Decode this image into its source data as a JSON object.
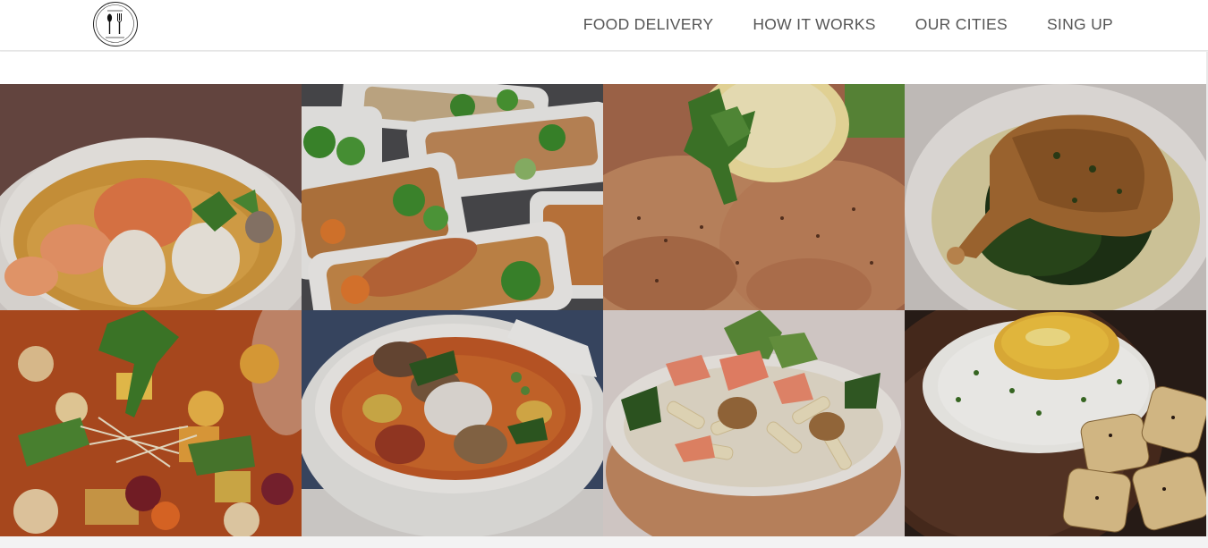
{
  "header": {
    "logo_icon": "fork-and-knife-logo",
    "nav": [
      {
        "label": "FOOD DELIVERY"
      },
      {
        "label": "HOW IT WORKS"
      },
      {
        "label": "OUR CITIES"
      },
      {
        "label": "SING UP"
      }
    ]
  },
  "gallery": {
    "photos": [
      {
        "name": "seafood-curry-photo"
      },
      {
        "name": "meal-prep-trays-photo"
      },
      {
        "name": "grilled-salmon-lemon-photo"
      },
      {
        "name": "roast-chicken-spinach-photo"
      },
      {
        "name": "minestrone-soup-photo"
      },
      {
        "name": "beef-vegetable-stew-photo"
      },
      {
        "name": "salmon-pasta-salad-photo"
      },
      {
        "name": "steak-egg-potatoes-photo"
      }
    ]
  },
  "colors": {
    "nav_text": "#555555",
    "header_bg": "#ffffff",
    "page_bg": "#f3f3f3"
  }
}
